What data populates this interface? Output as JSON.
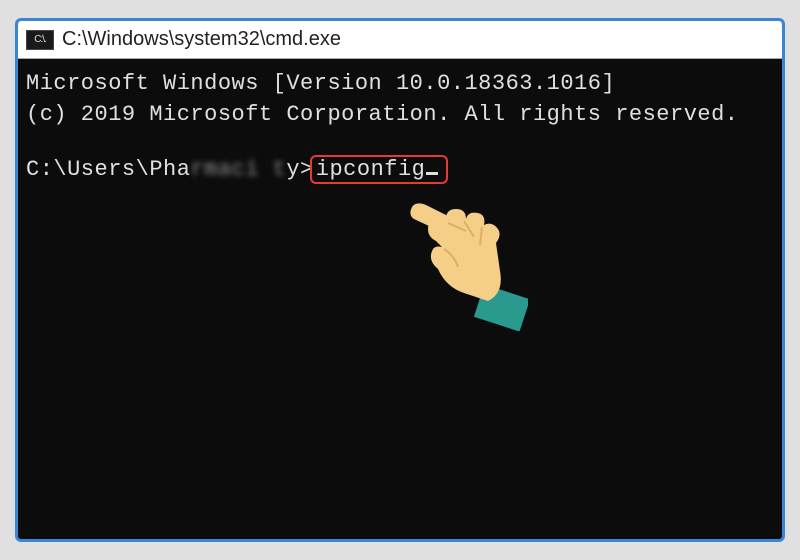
{
  "window": {
    "title": "C:\\Windows\\system32\\cmd.exe",
    "icon_label": "C:\\."
  },
  "terminal": {
    "header_line1": "Microsoft Windows [Version 10.0.18363.1016]",
    "header_line2": "(c) 2019 Microsoft Corporation. All rights reserved.",
    "prompt_prefix": "C:\\Users\\Pha",
    "prompt_blurred": "rmaci t",
    "prompt_suffix": "y>",
    "command": "ipconfig"
  },
  "annotation": {
    "highlight_color": "#e63939",
    "hand_skin": "#f5cf87",
    "hand_cuff": "#2a9a8f"
  }
}
